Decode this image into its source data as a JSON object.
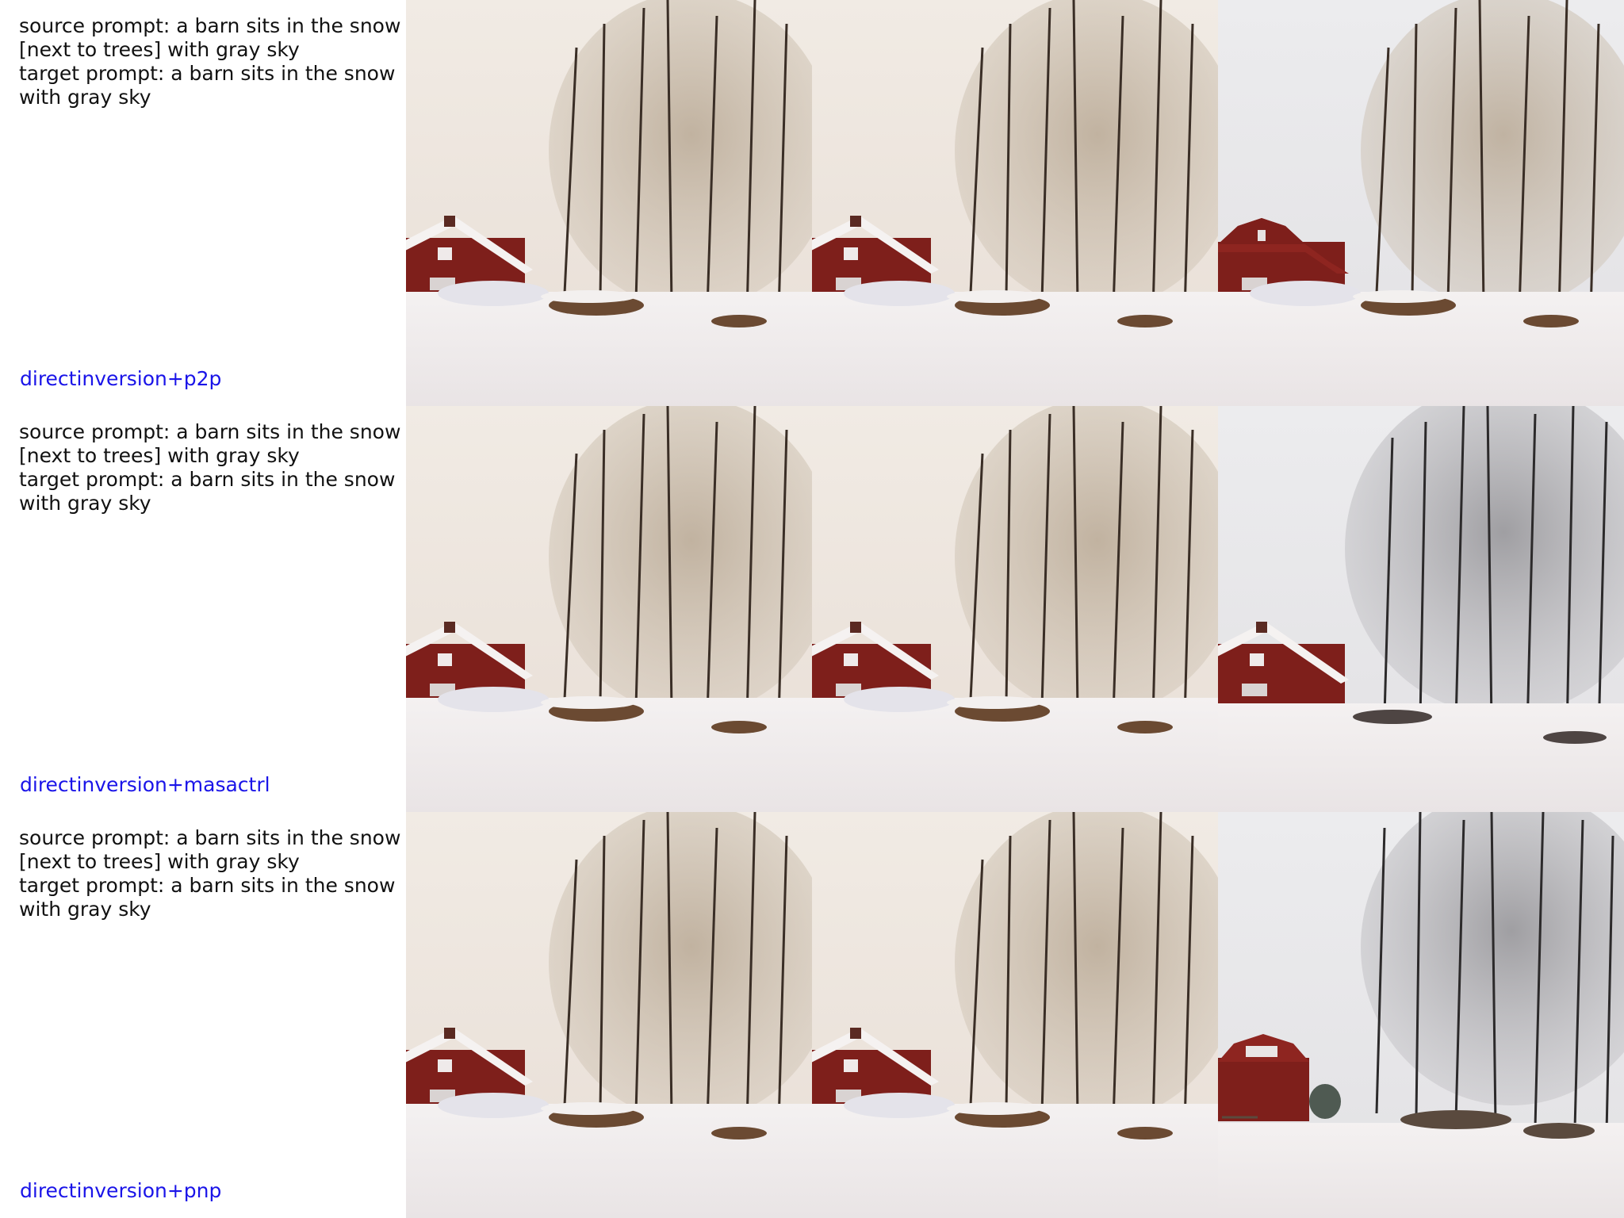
{
  "rows": [
    {
      "prompt_text": "source prompt: a barn sits in the snow\n[next to trees] with gray sky\ntarget prompt: a barn sits in the snow\nwith gray sky",
      "method": "directinversion+p2p"
    },
    {
      "prompt_text": "source prompt: a barn sits in the snow\n[next to trees] with gray sky\ntarget prompt: a barn sits in the snow\nwith gray sky",
      "method": "directinversion+masactrl"
    },
    {
      "prompt_text": "source prompt: a barn sits in the snow\n[next to trees] with gray sky\ntarget prompt: a barn sits in the snow\nwith gray sky",
      "method": "directinversion+pnp"
    }
  ],
  "colors": {
    "method_label": "#1a14e8",
    "barn_red": "#7e1f1b",
    "snow": "#f2efee",
    "sky_warm": "#efe7df",
    "sky_gray": "#e6e6e8"
  }
}
